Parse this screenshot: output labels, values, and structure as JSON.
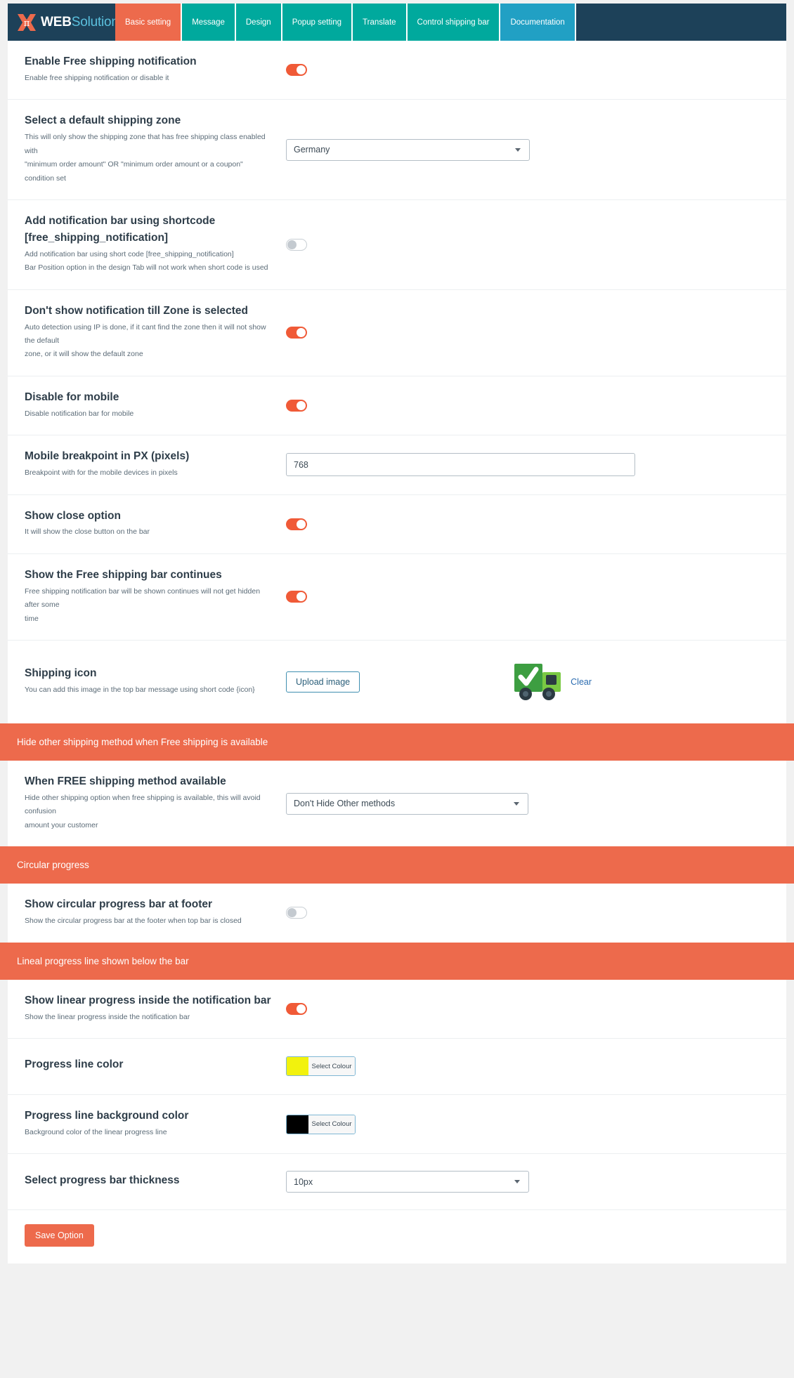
{
  "brand": {
    "name_bold": "WEB",
    "name_light": "Solution",
    "logo_icon": "x-logo-icon"
  },
  "nav": {
    "tabs": [
      {
        "label": "Basic setting",
        "state": "active"
      },
      {
        "label": "Message",
        "state": "normal"
      },
      {
        "label": "Design",
        "state": "normal"
      },
      {
        "label": "Popup setting",
        "state": "normal"
      },
      {
        "label": "Translate",
        "state": "normal"
      },
      {
        "label": "Control shipping bar",
        "state": "normal"
      },
      {
        "label": "Documentation",
        "state": "doc"
      }
    ]
  },
  "colors": {
    "accent_orange": "#ed6a4c",
    "toggle_on": "#f05a37",
    "teal": "#00a99d",
    "navy": "#1d4159",
    "doc_blue": "#21a0c4",
    "progress_line": "#f2f20d",
    "progress_line_bg": "#000000"
  },
  "rows": {
    "enable_notification": {
      "title": "Enable Free shipping notification",
      "desc": "Enable free shipping notification or disable it",
      "toggle": "on"
    },
    "default_zone": {
      "title": "Select a default shipping zone",
      "desc1": "This will only show the shipping zone that has free shipping class enabled with",
      "desc2": "\"minimum order amount\" OR \"minimum order amount or a coupon\" condition set",
      "value": "Germany"
    },
    "shortcode": {
      "title1": "Add notification bar using shortcode",
      "title2": "[free_shipping_notification]",
      "desc1": "Add notification bar using short code [free_shipping_notification]",
      "desc2": "Bar Position option in the design Tab will not work when short code is used",
      "toggle": "off"
    },
    "zone_selected": {
      "title": "Don't show notification till Zone is selected",
      "desc1": "Auto detection using IP is done, if it cant find the zone then it will not show the default",
      "desc2": "zone, or it will show the default zone",
      "toggle": "on"
    },
    "disable_mobile": {
      "title": "Disable for mobile",
      "desc": "Disable notification bar for mobile",
      "toggle": "on"
    },
    "breakpoint": {
      "title": "Mobile breakpoint in PX (pixels)",
      "desc": "Breakpoint with for the mobile devices in pixels",
      "value": "768"
    },
    "close_option": {
      "title": "Show close option",
      "desc": "It will show the close button on the bar",
      "toggle": "on"
    },
    "bar_continues": {
      "title": "Show the Free shipping bar continues",
      "desc1": "Free shipping notification bar will be shown continues will not get hidden after some",
      "desc2": "time",
      "toggle": "on"
    },
    "shipping_icon": {
      "title": "Shipping icon",
      "desc": "You can add this image in the top bar message using short code {icon}",
      "upload_label": "Upload image",
      "clear_label": "Clear",
      "image_icon": "delivery-truck-check-icon"
    },
    "free_method": {
      "title": "When FREE shipping method available",
      "desc1": "Hide other shipping option when free shipping is available, this will avoid confusion",
      "desc2": "amount your customer",
      "value": "Don't Hide Other methods"
    },
    "circular_footer": {
      "title": "Show circular progress bar at footer",
      "desc": "Show the circular progress bar at the footer when top bar is closed",
      "toggle": "off"
    },
    "linear_inside": {
      "title": "Show linear progress inside the notification bar",
      "desc": "Show the linear progress inside the notification bar",
      "toggle": "on"
    },
    "line_color": {
      "title": "Progress line color",
      "desc": "",
      "button_label": "Select Colour",
      "swatch": "#f2f20d"
    },
    "line_bg_color": {
      "title": "Progress line background color",
      "desc": "Background color of the linear progress line",
      "button_label": "Select Colour",
      "swatch": "#000000"
    },
    "bar_thickness": {
      "title": "Select progress bar thickness",
      "value": "10px"
    }
  },
  "sections": {
    "hide_other": "Hide other shipping method when Free shipping is available",
    "circular": "Circular progress",
    "lineal": "Lineal progress line shown below the bar"
  },
  "footer": {
    "save_label": "Save Option"
  }
}
